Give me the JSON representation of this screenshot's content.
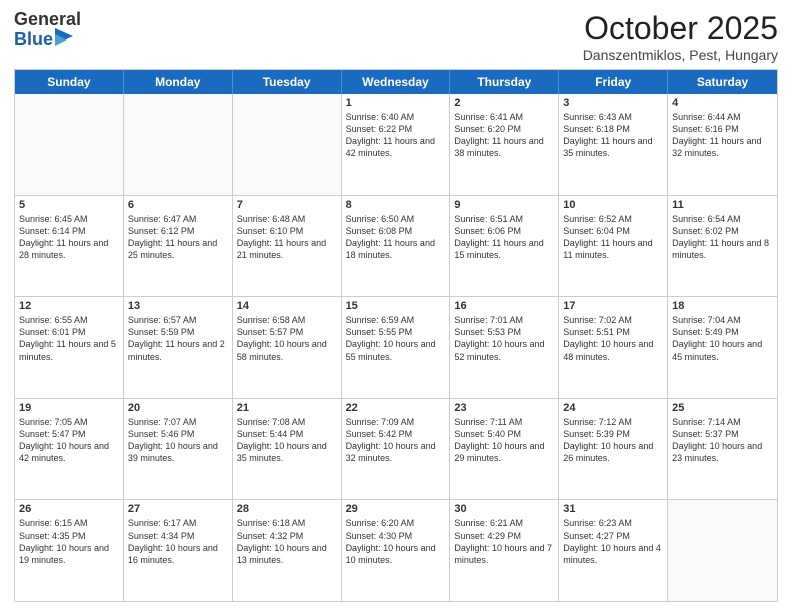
{
  "header": {
    "logo_general": "General",
    "logo_blue": "Blue",
    "month_title": "October 2025",
    "subtitle": "Danszentmiklos, Pest, Hungary"
  },
  "day_headers": [
    "Sunday",
    "Monday",
    "Tuesday",
    "Wednesday",
    "Thursday",
    "Friday",
    "Saturday"
  ],
  "weeks": [
    [
      {
        "day": "",
        "empty": true
      },
      {
        "day": "",
        "empty": true
      },
      {
        "day": "",
        "empty": true
      },
      {
        "day": "1",
        "sunrise": "6:40 AM",
        "sunset": "6:22 PM",
        "daylight": "11 hours and 42 minutes."
      },
      {
        "day": "2",
        "sunrise": "6:41 AM",
        "sunset": "6:20 PM",
        "daylight": "11 hours and 38 minutes."
      },
      {
        "day": "3",
        "sunrise": "6:43 AM",
        "sunset": "6:18 PM",
        "daylight": "11 hours and 35 minutes."
      },
      {
        "day": "4",
        "sunrise": "6:44 AM",
        "sunset": "6:16 PM",
        "daylight": "11 hours and 32 minutes."
      }
    ],
    [
      {
        "day": "5",
        "sunrise": "6:45 AM",
        "sunset": "6:14 PM",
        "daylight": "11 hours and 28 minutes."
      },
      {
        "day": "6",
        "sunrise": "6:47 AM",
        "sunset": "6:12 PM",
        "daylight": "11 hours and 25 minutes."
      },
      {
        "day": "7",
        "sunrise": "6:48 AM",
        "sunset": "6:10 PM",
        "daylight": "11 hours and 21 minutes."
      },
      {
        "day": "8",
        "sunrise": "6:50 AM",
        "sunset": "6:08 PM",
        "daylight": "11 hours and 18 minutes."
      },
      {
        "day": "9",
        "sunrise": "6:51 AM",
        "sunset": "6:06 PM",
        "daylight": "11 hours and 15 minutes."
      },
      {
        "day": "10",
        "sunrise": "6:52 AM",
        "sunset": "6:04 PM",
        "daylight": "11 hours and 11 minutes."
      },
      {
        "day": "11",
        "sunrise": "6:54 AM",
        "sunset": "6:02 PM",
        "daylight": "11 hours and 8 minutes."
      }
    ],
    [
      {
        "day": "12",
        "sunrise": "6:55 AM",
        "sunset": "6:01 PM",
        "daylight": "11 hours and 5 minutes."
      },
      {
        "day": "13",
        "sunrise": "6:57 AM",
        "sunset": "5:59 PM",
        "daylight": "11 hours and 2 minutes."
      },
      {
        "day": "14",
        "sunrise": "6:58 AM",
        "sunset": "5:57 PM",
        "daylight": "10 hours and 58 minutes."
      },
      {
        "day": "15",
        "sunrise": "6:59 AM",
        "sunset": "5:55 PM",
        "daylight": "10 hours and 55 minutes."
      },
      {
        "day": "16",
        "sunrise": "7:01 AM",
        "sunset": "5:53 PM",
        "daylight": "10 hours and 52 minutes."
      },
      {
        "day": "17",
        "sunrise": "7:02 AM",
        "sunset": "5:51 PM",
        "daylight": "10 hours and 48 minutes."
      },
      {
        "day": "18",
        "sunrise": "7:04 AM",
        "sunset": "5:49 PM",
        "daylight": "10 hours and 45 minutes."
      }
    ],
    [
      {
        "day": "19",
        "sunrise": "7:05 AM",
        "sunset": "5:47 PM",
        "daylight": "10 hours and 42 minutes."
      },
      {
        "day": "20",
        "sunrise": "7:07 AM",
        "sunset": "5:46 PM",
        "daylight": "10 hours and 39 minutes."
      },
      {
        "day": "21",
        "sunrise": "7:08 AM",
        "sunset": "5:44 PM",
        "daylight": "10 hours and 35 minutes."
      },
      {
        "day": "22",
        "sunrise": "7:09 AM",
        "sunset": "5:42 PM",
        "daylight": "10 hours and 32 minutes."
      },
      {
        "day": "23",
        "sunrise": "7:11 AM",
        "sunset": "5:40 PM",
        "daylight": "10 hours and 29 minutes."
      },
      {
        "day": "24",
        "sunrise": "7:12 AM",
        "sunset": "5:39 PM",
        "daylight": "10 hours and 26 minutes."
      },
      {
        "day": "25",
        "sunrise": "7:14 AM",
        "sunset": "5:37 PM",
        "daylight": "10 hours and 23 minutes."
      }
    ],
    [
      {
        "day": "26",
        "sunrise": "6:15 AM",
        "sunset": "4:35 PM",
        "daylight": "10 hours and 19 minutes."
      },
      {
        "day": "27",
        "sunrise": "6:17 AM",
        "sunset": "4:34 PM",
        "daylight": "10 hours and 16 minutes."
      },
      {
        "day": "28",
        "sunrise": "6:18 AM",
        "sunset": "4:32 PM",
        "daylight": "10 hours and 13 minutes."
      },
      {
        "day": "29",
        "sunrise": "6:20 AM",
        "sunset": "4:30 PM",
        "daylight": "10 hours and 10 minutes."
      },
      {
        "day": "30",
        "sunrise": "6:21 AM",
        "sunset": "4:29 PM",
        "daylight": "10 hours and 7 minutes."
      },
      {
        "day": "31",
        "sunrise": "6:23 AM",
        "sunset": "4:27 PM",
        "daylight": "10 hours and 4 minutes."
      },
      {
        "day": "",
        "empty": true
      }
    ]
  ]
}
